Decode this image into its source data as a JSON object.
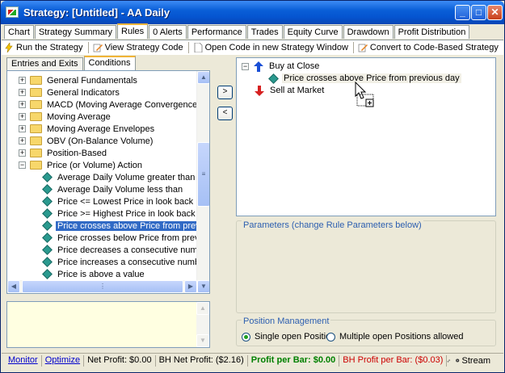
{
  "window": {
    "title": "Strategy: [Untitled] - AA Daily",
    "min": "_",
    "max": "□",
    "close": "✕"
  },
  "tabs": [
    "Chart",
    "Strategy Summary",
    "Rules",
    "0 Alerts",
    "Performance",
    "Trades",
    "Equity Curve",
    "Drawdown",
    "Profit Distribution"
  ],
  "active_tab": "Rules",
  "toolbar": {
    "run": "Run the Strategy",
    "view": "View Strategy Code",
    "open": "Open Code in new Strategy Window",
    "convert": "Convert to Code-Based Strategy"
  },
  "left_tabs": [
    "Entries and Exits",
    "Conditions"
  ],
  "tree": {
    "folders": [
      "General Fundamentals",
      "General Indicators",
      "MACD (Moving Average Convergence/Diverge",
      "Moving Average",
      "Moving Average Envelopes",
      "OBV (On-Balance Volume)",
      "Position-Based",
      "Price (or Volume) Action"
    ],
    "leaves": [
      "Average Daily Volume greater than",
      "Average Daily Volume less than",
      "Price <= Lowest Price in look back period",
      "Price >= Highest Price in look back period",
      "Price crosses above Price from previous da",
      "Price crosses below Price from previous da",
      "Price decreases a consecutive number of",
      "Price increases a consecutive number of b",
      "Price is above a value"
    ],
    "selected": "Price crosses above Price from previous da"
  },
  "arrows": {
    "add": ">",
    "remove": "<"
  },
  "rules": {
    "buy": "Buy at Close",
    "buy_condition": "Price crosses above Price from previous day",
    "sell": "Sell at Market"
  },
  "params": {
    "legend": "Parameters (change Rule Parameters below)"
  },
  "position": {
    "legend": "Position Management",
    "single": "Single open Position",
    "multiple": "Multiple open Positions allowed"
  },
  "status": {
    "monitor": "Monitor",
    "optimize": "Optimize",
    "net_profit": "Net Profit: $0.00",
    "bh_net": "BH Net Profit: ($2.16)",
    "ppb": "Profit per Bar: $0.00",
    "bh_ppb": "BH Profit per Bar: ($0.03)",
    "stream": "Stream"
  },
  "colors": {
    "accent": "#316ac5",
    "titlebar": "#0554d0",
    "buy_arrow": "#1a4fd6",
    "sell_arrow": "#d62020"
  }
}
